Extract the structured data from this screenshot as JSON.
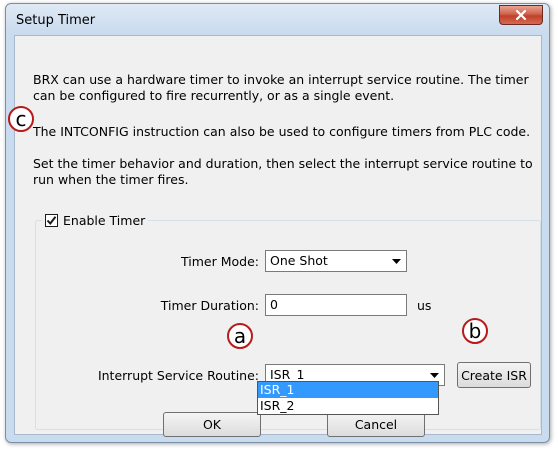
{
  "window": {
    "title": "Setup Timer"
  },
  "description": {
    "paragraph1": "BRX can use a hardware timer to invoke an interrupt service routine. The timer can be configured to fire recurrently, or as a single event.",
    "paragraph2": "The INTCONFIG instruction can also be used to configure timers from PLC code.",
    "paragraph3": "Set the timer behavior and duration, then select the interrupt service routine to run when the timer fires."
  },
  "group": {
    "enable_label": "Enable Timer",
    "enable_checked": true
  },
  "timer_mode": {
    "label": "Timer Mode:",
    "value": "One Shot"
  },
  "timer_duration": {
    "label": "Timer Duration:",
    "value": "0",
    "unit": "us"
  },
  "isr": {
    "label": "Interrupt Service Routine:",
    "value": "ISR_1",
    "options": [
      "ISR_1",
      "ISR_2"
    ],
    "selected_index": 0
  },
  "buttons": {
    "create_isr": "Create ISR",
    "ok": "OK",
    "cancel": "Cancel"
  },
  "callouts": {
    "a": "a",
    "b": "b",
    "c": "c"
  },
  "colors": {
    "callout_border": "#b61a1a",
    "selection": "#3399ff"
  }
}
